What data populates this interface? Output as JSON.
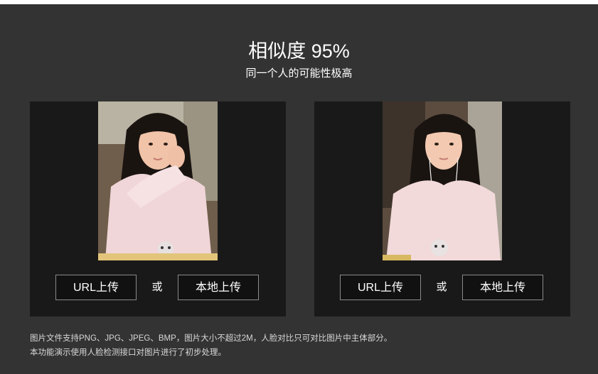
{
  "result": {
    "title": "相似度 95%",
    "similarity_percent": 95,
    "subtitle": "同一个人的可能性极高"
  },
  "panels": [
    {
      "photo_icon": "portrait-photo",
      "url_upload_label": "URL上传",
      "or_label": "或",
      "local_upload_label": "本地上传"
    },
    {
      "photo_icon": "portrait-photo",
      "url_upload_label": "URL上传",
      "or_label": "或",
      "local_upload_label": "本地上传"
    }
  ],
  "notes": [
    "图片文件支持PNG、JPG、JPEG、BMP，图片大小不超过2M，人脸对比只可对比图片中主体部分。",
    "本功能演示使用人脸检测接口对图片进行了初步处理。"
  ],
  "colors": {
    "background": "#333333",
    "panel": "#191919",
    "button_border": "#8a8a8a",
    "text": "#ffffff"
  }
}
